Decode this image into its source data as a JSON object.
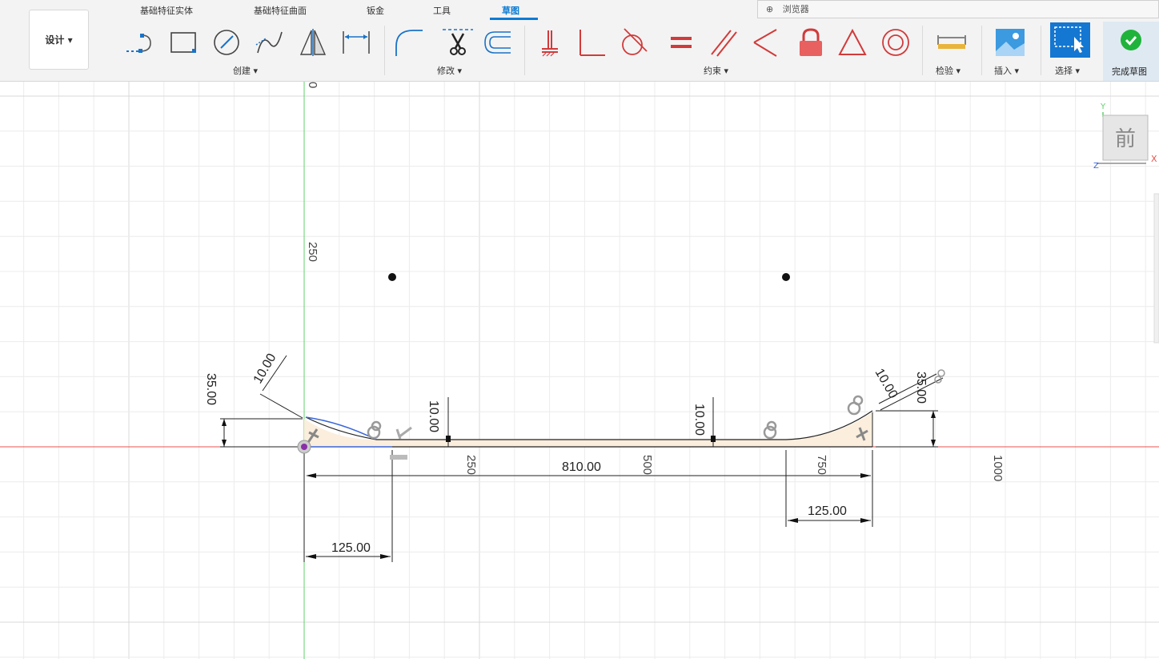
{
  "browser_label": "浏览器",
  "tabs": [
    {
      "label": "基础特征实体"
    },
    {
      "label": "基础特征曲面"
    },
    {
      "label": "钣金"
    },
    {
      "label": "工具"
    },
    {
      "label": "草图"
    }
  ],
  "design_button": "设计 ▾",
  "groups": {
    "create": "创建 ▾",
    "modify": "修改 ▾",
    "constraints": "约束 ▾",
    "inspect": "检验 ▾",
    "insert": "插入 ▾",
    "select": "选择 ▾",
    "finish": "完成草图"
  },
  "icons": {
    "create": [
      "line-icon",
      "rectangle-icon",
      "circle-icon",
      "spline-icon",
      "mirror-icon",
      "dimension-icon"
    ],
    "modify": [
      "fillet-icon",
      "trim-icon",
      "offset-icon"
    ],
    "constraints": [
      "fix-icon",
      "perpendicular-icon",
      "tangent-icon",
      "equal-icon",
      "parallel-icon",
      "coincident-icon",
      "lock-icon",
      "triangle-icon",
      "concentric-icon"
    ]
  },
  "viewcube": {
    "face": "前",
    "x": "X",
    "y": "Y",
    "z": "Z"
  },
  "axis_labels": {
    "y250": "250",
    "y0": "0",
    "x250": "250",
    "x500": "500",
    "x750": "750",
    "x1000": "1000"
  },
  "dimensions": {
    "left_height": "35.00",
    "left_thickness": "10.00",
    "mid_left_thickness": "10.00",
    "mid_right_thickness": "10.00",
    "right_height": "35.00",
    "right_thickness": "10.00",
    "total_length": "810.00",
    "left_length": "125.00",
    "right_length": "125.00"
  },
  "colors": {
    "accent": "#0a7bd4",
    "x_axis": "#e8534c",
    "y_axis": "#5fd16a",
    "selected": "#3a66d8",
    "profile_fill": "#fbeedd",
    "finish_check": "#1fb33b"
  }
}
